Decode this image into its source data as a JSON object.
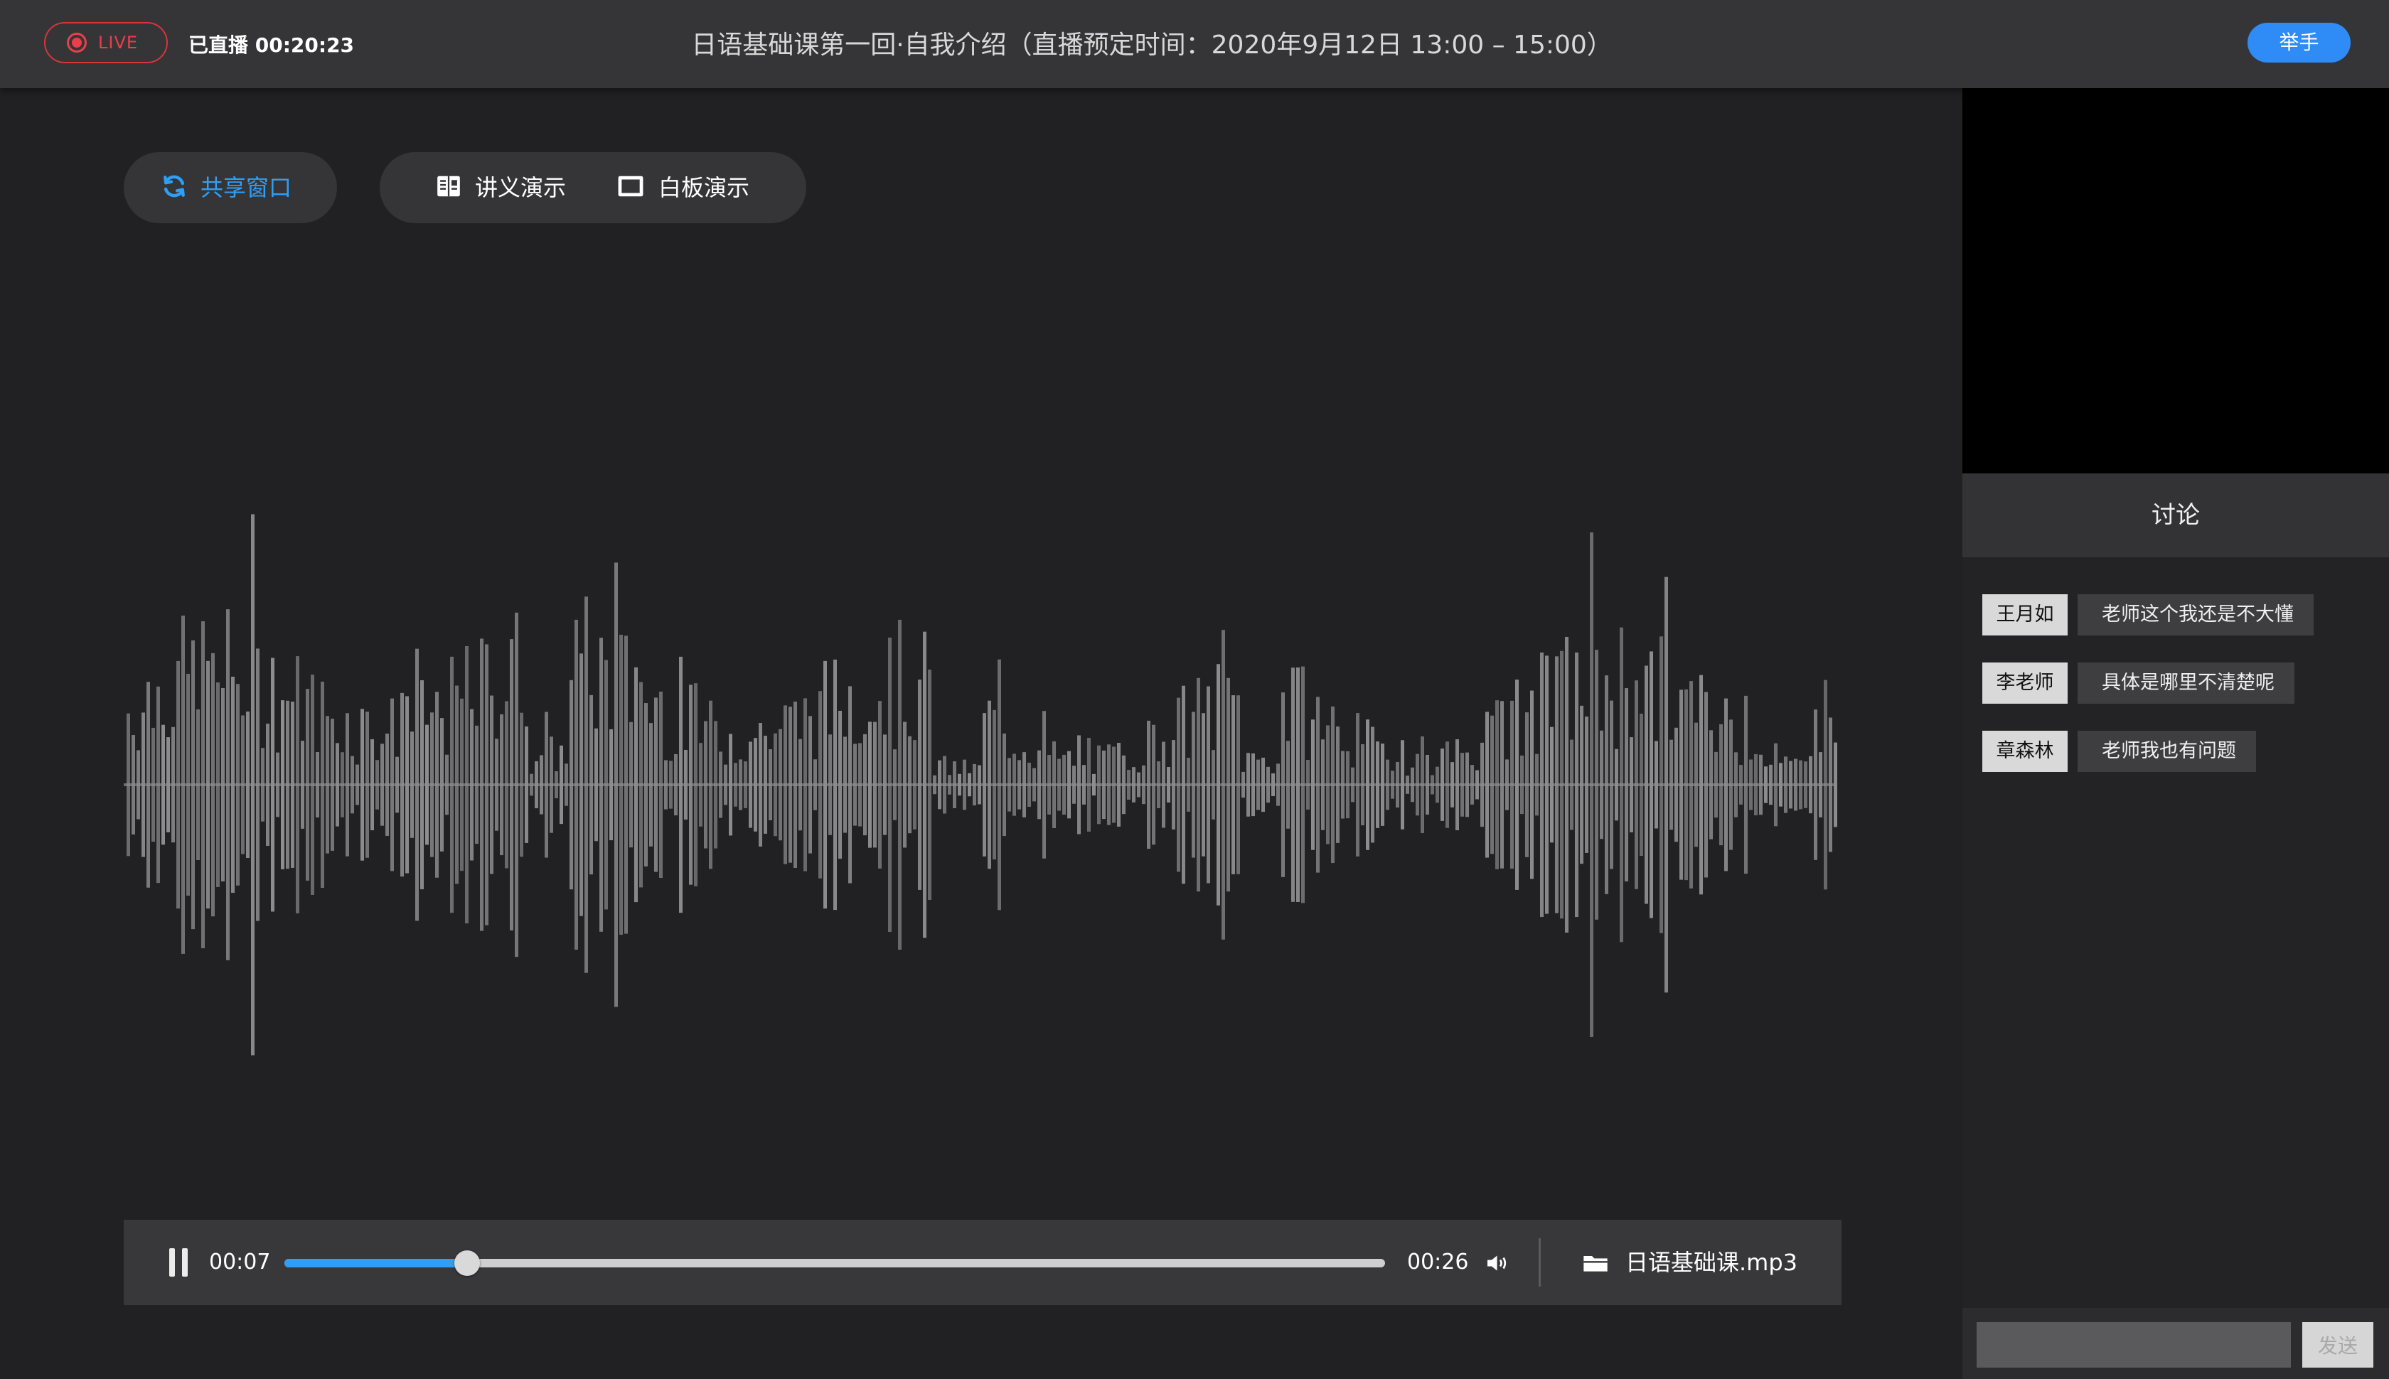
{
  "header": {
    "live_label": "LIVE",
    "elapsed": "已直播 00:20:23",
    "title": "日语基础课第一回·自我介绍（直播预定时间：2020年9月12日 13:00 – 15:00）",
    "raise_hand": "举手"
  },
  "toolbar": {
    "share_label": "共享窗口",
    "lecture_label": "讲义演示",
    "whiteboard_label": "白板演示"
  },
  "player": {
    "current_time": "00:07",
    "total_time": "00:26",
    "progress": 0.166,
    "file_name": "日语基础课.mp3"
  },
  "discussion": {
    "title": "讨论",
    "messages": [
      {
        "user": "王月如",
        "text": "老师这个我还是不大懂"
      },
      {
        "user": "李老师",
        "text": "具体是哪里不清楚呢"
      },
      {
        "user": "章森林",
        "text": "老师我也有问题"
      }
    ],
    "input_placeholder": "",
    "send_label": "发送"
  },
  "colors": {
    "accent": "#2f9ef5",
    "live": "#e8404a",
    "raise_hand": "#2f8bf5",
    "waveform": "#8e8e90"
  },
  "icons": {
    "share": "refresh-icon",
    "lecture": "document-icon",
    "whiteboard": "board-icon",
    "pause": "pause-icon",
    "volume": "speaker-icon",
    "file": "folder-icon"
  }
}
